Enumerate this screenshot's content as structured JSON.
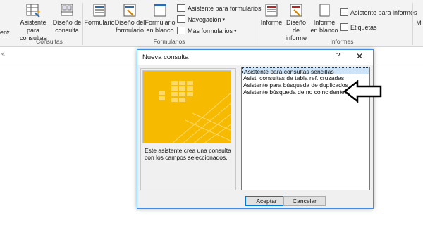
{
  "ribbon": {
    "left_partial_label": "ent",
    "consultas": {
      "group_label": "Consultas",
      "wizard_label_1": "Asistente para",
      "wizard_label_2": "consultas",
      "design_label_1": "Diseño de",
      "design_label_2": "consulta"
    },
    "formularios": {
      "group_label": "Formularios",
      "form_label": "Formulario",
      "form_design_1": "Diseño del",
      "form_design_2": "formulario",
      "blank_form_1": "Formulario",
      "blank_form_2": "en blanco",
      "form_wizard": "Asistente para formularios",
      "navigation": "Navegación",
      "more_forms": "Más formularios"
    },
    "informes": {
      "group_label": "Informes",
      "report_label": "Informe",
      "report_design_1": "Diseño de",
      "report_design_2": "informe",
      "blank_report_1": "Informe",
      "blank_report_2": "en blanco",
      "report_wizard": "Asistente para informes",
      "labels": "Etiquetas",
      "partial_right": "M"
    }
  },
  "dialog": {
    "title": "Nueva consulta",
    "help": "?",
    "close": "✕",
    "description": "Este asistente crea una consulta con los campos seleccionados.",
    "options": [
      "Asistente para consultas sencillas",
      "Asist. consultas de tabla ref. cruzadas",
      "Asistente para búsqueda de duplicados",
      "Asistente búsqueda de no coincidentes"
    ],
    "selected_index": 0,
    "ok_label": "Aceptar",
    "cancel_label": "Cancelar"
  },
  "colors": {
    "preview_bg": "#f5b800",
    "selection_bg": "#cde3f7",
    "dialog_border": "#3c8ee8"
  },
  "icons": [
    "query-wizard-icon",
    "query-design-icon",
    "form-icon",
    "form-design-icon",
    "blank-form-icon",
    "report-icon",
    "report-design-icon",
    "blank-report-icon",
    "arrow-pointer-icon"
  ]
}
